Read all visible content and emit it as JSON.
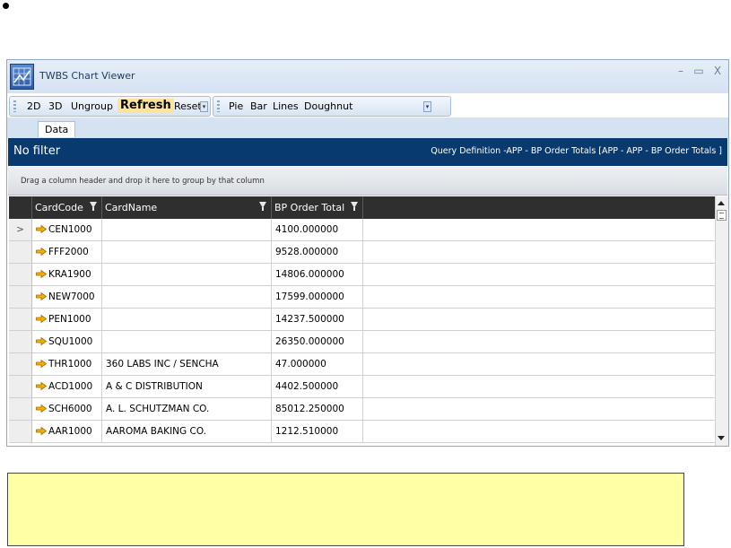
{
  "window": {
    "title": "TWBS Chart Viewer",
    "minimize_glyph": "–",
    "maximize_glyph": "▭",
    "close_glyph": "X"
  },
  "toolbar1": {
    "btn_2d": "2D",
    "btn_3d": "3D",
    "btn_ungroup": "Ungroup",
    "btn_refresh": "Refresh",
    "btn_reset": "Reset"
  },
  "toolbar2": {
    "btn_pie": "Pie",
    "btn_bar": "Bar",
    "btn_lines": "Lines",
    "btn_doughnut": "Doughnut"
  },
  "tabs": {
    "data": "Data"
  },
  "filterbar": {
    "left": "No filter",
    "right": "Query Definition -APP - BP Order Totals [APP - APP - BP Order Totals ]"
  },
  "groupbar": {
    "hint": "Drag a column header and drop it here to group by that column"
  },
  "grid": {
    "columns": [
      "CardCode",
      "CardName",
      "BP Order Total"
    ],
    "current_row_glyph": ">",
    "rows": [
      {
        "code": "CEN1000",
        "name": "",
        "total": "4100.000000"
      },
      {
        "code": "FFF2000",
        "name": "",
        "total": "9528.000000"
      },
      {
        "code": "KRA1900",
        "name": "",
        "total": "14806.000000"
      },
      {
        "code": "NEW7000",
        "name": "",
        "total": "17599.000000"
      },
      {
        "code": "PEN1000",
        "name": "",
        "total": "14237.500000"
      },
      {
        "code": "SQU1000",
        "name": "",
        "total": "26350.000000"
      },
      {
        "code": "THR1000",
        "name": "360 LABS INC / SENCHA",
        "total": "47.000000"
      },
      {
        "code": "ACD1000",
        "name": "A & C DISTRIBUTION",
        "total": "4402.500000"
      },
      {
        "code": "SCH6000",
        "name": "A. L. SCHUTZMAN CO.",
        "total": "85012.250000"
      },
      {
        "code": "AAR1000",
        "name": "AAROMA BAKING CO.",
        "total": "1212.510000"
      }
    ]
  },
  "colors": {
    "filterbar_bg": "#083a6f",
    "header_bg": "#2f2f2f",
    "refresh_highlight": "#fde49a",
    "note_bg": "#ffffa5",
    "arrow_icon": "#f0a000"
  }
}
